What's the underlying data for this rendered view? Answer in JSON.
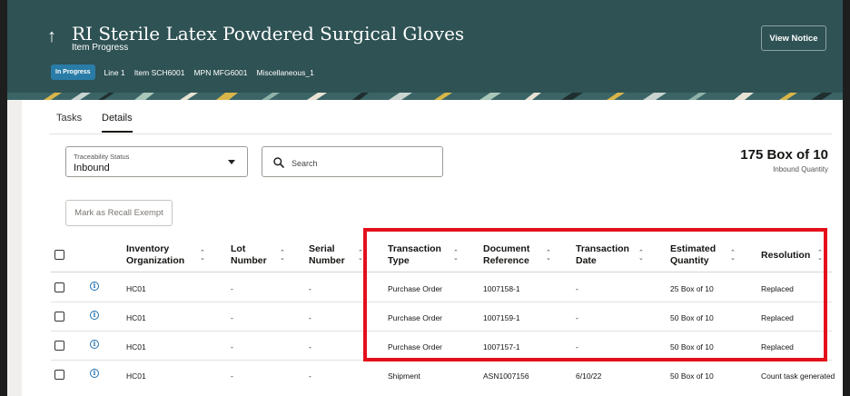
{
  "header": {
    "title": "RI Sterile Latex Powdered Surgical Gloves",
    "subtitle": "Item Progress",
    "status_badge": "In Progress",
    "meta": [
      "Line 1",
      "Item SCH6001",
      "MPN MFG6001",
      "Miscellaneous_1"
    ],
    "view_notice_label": "View Notice",
    "back_icon": "up-arrow-icon",
    "background_color": "#2f5254",
    "badge_color": "#2a7ca8"
  },
  "tabs": [
    {
      "label": "Tasks",
      "selected": false
    },
    {
      "label": "Details",
      "selected": true
    }
  ],
  "filters": {
    "traceability_label": "Traceability Status",
    "traceability_value": "Inbound",
    "search_placeholder": "Search"
  },
  "summary": {
    "quantity": "175 Box of 10",
    "quantity_label": "Inbound Quantity"
  },
  "actions": {
    "recall_exempt_label": "Mark as Recall Exempt"
  },
  "table": {
    "columns": [
      {
        "label_line1": "Inventory",
        "label_line2": "Organization"
      },
      {
        "label_line1": "Lot",
        "label_line2": "Number"
      },
      {
        "label_line1": "Serial",
        "label_line2": "Number"
      },
      {
        "label_line1": "Transaction",
        "label_line2": "Type"
      },
      {
        "label_line1": "Document",
        "label_line2": "Reference"
      },
      {
        "label_line1": "Transaction",
        "label_line2": "Date"
      },
      {
        "label_line1": "Estimated",
        "label_line2": "Quantity"
      },
      {
        "label_line1": "Resolution",
        "label_line2": ""
      }
    ],
    "rows": [
      {
        "org": "HC01",
        "lot": "-",
        "serial": "-",
        "type": "Purchase Order",
        "doc": "1007158-1",
        "date": "-",
        "qty": "25 Box of 10",
        "resolution": "Replaced"
      },
      {
        "org": "HC01",
        "lot": "-",
        "serial": "-",
        "type": "Purchase Order",
        "doc": "1007159-1",
        "date": "-",
        "qty": "50 Box of 10",
        "resolution": "Replaced"
      },
      {
        "org": "HC01",
        "lot": "-",
        "serial": "-",
        "type": "Purchase Order",
        "doc": "1007157-1",
        "date": "-",
        "qty": "50 Box of 10",
        "resolution": "Replaced"
      },
      {
        "org": "HC01",
        "lot": "-",
        "serial": "-",
        "type": "Shipment",
        "doc": "ASN1007156",
        "date": "6/10/22",
        "qty": "50 Box of 10",
        "resolution": "Count task generated"
      }
    ]
  },
  "highlight_color": "#e3101b"
}
